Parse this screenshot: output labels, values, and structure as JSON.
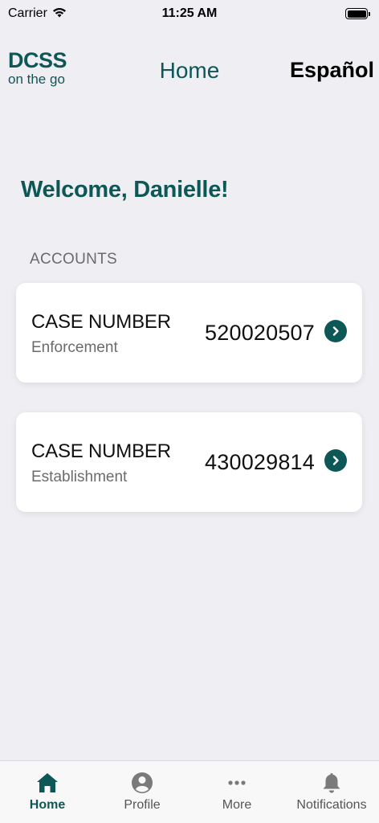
{
  "status_bar": {
    "carrier": "Carrier",
    "time": "11:25 AM"
  },
  "header": {
    "logo_main": "DCSS",
    "logo_sub": "on the go",
    "title": "Home",
    "language_button": "Español"
  },
  "main": {
    "welcome": "Welcome, Danielle!",
    "section_label": "ACCOUNTS",
    "accounts": [
      {
        "label": "CASE NUMBER",
        "type": "Enforcement",
        "number": "520020507"
      },
      {
        "label": "CASE NUMBER",
        "type": "Establishment",
        "number": "430029814"
      }
    ]
  },
  "tab_bar": {
    "tabs": [
      {
        "label": "Home",
        "icon": "home-icon",
        "active": true
      },
      {
        "label": "Profile",
        "icon": "profile-icon",
        "active": false
      },
      {
        "label": "More",
        "icon": "more-icon",
        "active": false
      },
      {
        "label": "Notifications",
        "icon": "bell-icon",
        "active": false
      }
    ]
  },
  "colors": {
    "brand": "#0e5757",
    "background": "#efeef3",
    "card": "#ffffff",
    "muted_text": "#6b6b6b"
  }
}
